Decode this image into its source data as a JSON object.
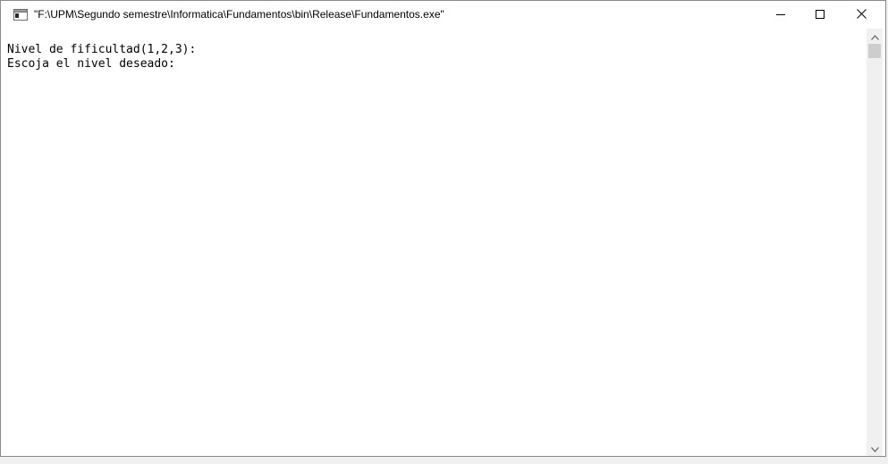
{
  "window": {
    "title": "\"F:\\UPM\\Segundo semestre\\Informatica\\Fundamentos\\bin\\Release\\Fundamentos.exe\"",
    "icon": "console-app-icon",
    "controls": {
      "minimize_icon": "minimize-icon",
      "maximize_icon": "maximize-icon",
      "close_icon": "close-icon"
    }
  },
  "console": {
    "lines": [
      "Nivel de fificultad(1,2,3):",
      "Escoja el nivel deseado:"
    ],
    "background": "#ffffff",
    "text_color": "#000000"
  },
  "scrollbar": {
    "up_icon": "chevron-up-icon",
    "down_icon": "chevron-down-icon"
  }
}
